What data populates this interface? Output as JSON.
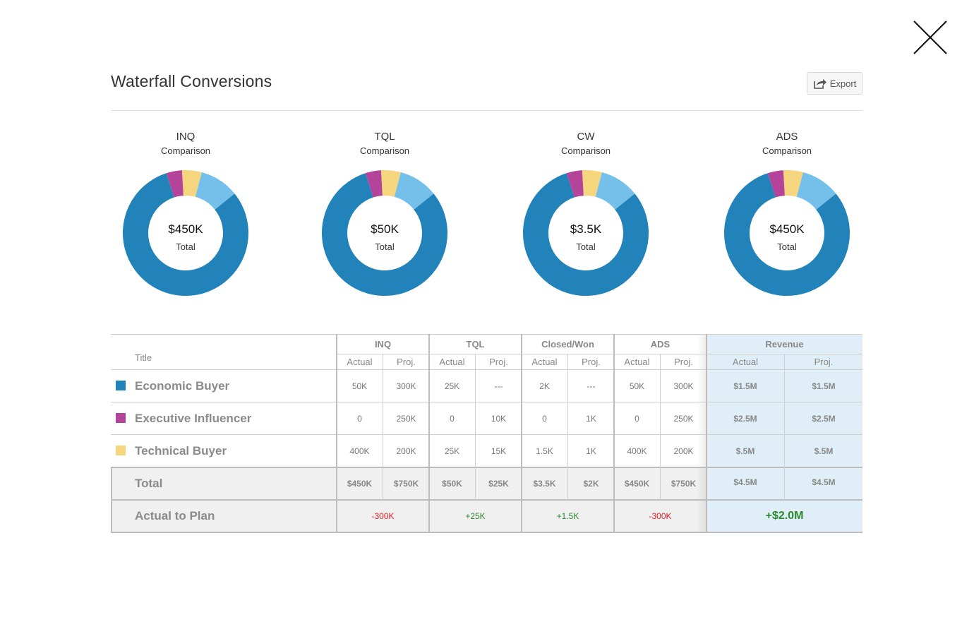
{
  "page": {
    "title": "Waterfall Conversions",
    "export_label": "Export"
  },
  "icons": {
    "close": "close-icon",
    "export": "share-arrow-icon"
  },
  "colors": {
    "economic_buyer": "#2183b9",
    "executive_influencer": "#b4449a",
    "technical_buyer": "#f5d67e",
    "other": "#74c0ea",
    "negative": "#e0202a",
    "positive": "#2c8a2c",
    "revenue_bg": "#dfeef7"
  },
  "donuts": [
    {
      "title": "INQ",
      "subtitle": "Comparison",
      "value": "$450K",
      "label": "Total"
    },
    {
      "title": "TQL",
      "subtitle": "Comparison",
      "value": "$50K",
      "label": "Total"
    },
    {
      "title": "CW",
      "subtitle": "Comparison",
      "value": "$3.5K",
      "label": "Total"
    },
    {
      "title": "ADS",
      "subtitle": "Comparison",
      "value": "$450K",
      "label": "Total"
    }
  ],
  "chart_data": [
    {
      "type": "pie",
      "title": "INQ",
      "subtitle": "Comparison",
      "center": "$450K Total",
      "slices": [
        {
          "color": "#74c0ea",
          "value": 10
        },
        {
          "color": "#2183b9",
          "value": 80
        },
        {
          "color": "#b4449a",
          "value": 4
        },
        {
          "color": "#f5d67e",
          "value": 5
        }
      ]
    },
    {
      "type": "pie",
      "title": "TQL",
      "subtitle": "Comparison",
      "center": "$50K Total",
      "slices": [
        {
          "color": "#74c0ea",
          "value": 10
        },
        {
          "color": "#2183b9",
          "value": 80
        },
        {
          "color": "#b4449a",
          "value": 4
        },
        {
          "color": "#f5d67e",
          "value": 5
        }
      ]
    },
    {
      "type": "pie",
      "title": "CW",
      "subtitle": "Comparison",
      "center": "$3.5K Total",
      "slices": [
        {
          "color": "#74c0ea",
          "value": 10
        },
        {
          "color": "#2183b9",
          "value": 80
        },
        {
          "color": "#b4449a",
          "value": 4
        },
        {
          "color": "#f5d67e",
          "value": 5
        }
      ]
    },
    {
      "type": "pie",
      "title": "ADS",
      "subtitle": "Comparison",
      "center": "$450K Total",
      "slices": [
        {
          "color": "#74c0ea",
          "value": 10
        },
        {
          "color": "#2183b9",
          "value": 80
        },
        {
          "color": "#b4449a",
          "value": 4
        },
        {
          "color": "#f5d67e",
          "value": 5
        }
      ]
    }
  ],
  "table": {
    "title_header": "Title",
    "groups": [
      "INQ",
      "TQL",
      "Closed/Won",
      "ADS",
      "Revenue"
    ],
    "sub_headers": [
      "Actual",
      "Proj."
    ],
    "rows": [
      {
        "title": "Economic Buyer",
        "color": "#2183b9",
        "values": [
          "50K",
          "300K",
          "25K",
          "---",
          "2K",
          "---",
          "50K",
          "300K"
        ],
        "revenue": [
          "$1.5M",
          "$1.5M"
        ]
      },
      {
        "title": "Executive Influencer",
        "color": "#b4449a",
        "values": [
          "0",
          "250K",
          "0",
          "10K",
          "0",
          "1K",
          "0",
          "250K"
        ],
        "revenue": [
          "$2.5M",
          "$2.5M"
        ]
      },
      {
        "title": "Technical Buyer",
        "color": "#f5d67e",
        "values": [
          "400K",
          "200K",
          "25K",
          "15K",
          "1.5K",
          "1K",
          "400K",
          "200K"
        ],
        "revenue": [
          "$.5M",
          "$.5M"
        ]
      }
    ],
    "total": {
      "title": "Total",
      "values": [
        "$450K",
        "$750K",
        "$50K",
        "$25K",
        "$3.5K",
        "$2K",
        "$450K",
        "$750K"
      ],
      "revenue": [
        "$4.5M",
        "$4.5M"
      ]
    },
    "actual_to_plan": {
      "title": "Actual to Plan",
      "values": [
        "-300K",
        "+25K",
        "+1.5K",
        "-300K"
      ],
      "signs": [
        "negative",
        "positive",
        "positive",
        "negative"
      ],
      "revenue": "+$2.0M"
    }
  }
}
